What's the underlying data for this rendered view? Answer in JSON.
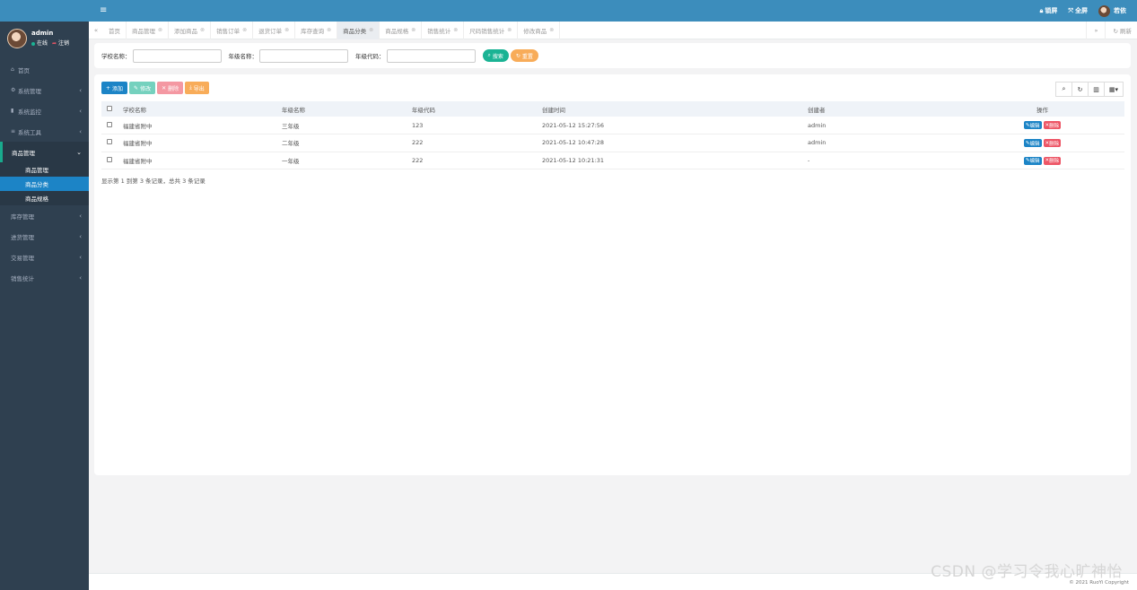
{
  "sidebar": {
    "user": {
      "name": "admin",
      "status": "在线",
      "logout": "注销"
    },
    "menu": [
      {
        "label": "首页",
        "icon": "home-icon"
      },
      {
        "label": "系统管理",
        "icon": "gear-icon"
      },
      {
        "label": "系统监控",
        "icon": "video-icon"
      },
      {
        "label": "系统工具",
        "icon": "bars-icon"
      },
      {
        "label": "商品管理",
        "open": true
      },
      {
        "label": "库存管理"
      },
      {
        "label": "进货管理"
      },
      {
        "label": "交易管理"
      },
      {
        "label": "销售统计"
      }
    ],
    "submenu": [
      {
        "label": "商品管理"
      },
      {
        "label": "商品分类",
        "active": true
      },
      {
        "label": "商品规格"
      }
    ]
  },
  "topbar": {
    "lock": "锁屏",
    "fullscreen": "全屏",
    "user": "若依"
  },
  "tabs": [
    {
      "label": "首页"
    },
    {
      "label": "商品管理"
    },
    {
      "label": "添加商品"
    },
    {
      "label": "销售订单"
    },
    {
      "label": "退货订单"
    },
    {
      "label": "库存查询"
    },
    {
      "label": "商品分类",
      "active": true
    },
    {
      "label": "商品规格"
    },
    {
      "label": "销售统计"
    },
    {
      "label": "尺码销售统计"
    },
    {
      "label": "修改商品"
    }
  ],
  "tabs_refresh": "刷新",
  "search": {
    "school_label": "学校名称：",
    "grade_label": "年级名称：",
    "code_label": "年级代码：",
    "search_btn": "搜索",
    "reset_btn": "重置"
  },
  "toolbar": {
    "add": "添加",
    "edit": "修改",
    "delete": "删除",
    "export": "导出"
  },
  "table": {
    "headers": [
      "学校名称",
      "年级名称",
      "年级代码",
      "创建时间",
      "创建者",
      "操作"
    ],
    "rows": [
      [
        "福建省附中",
        "三年级",
        "123",
        "2021-05-12 15:27:56",
        "admin"
      ],
      [
        "福建省附中",
        "二年级",
        "222",
        "2021-05-12 10:47:28",
        "admin"
      ],
      [
        "福建省附中",
        "一年级",
        "222",
        "2021-05-12 10:21:31",
        "-"
      ]
    ],
    "op_edit": "编辑",
    "op_delete": "删除"
  },
  "pager": "显示第 1 到第 3 条记录，总共 3 条记录",
  "footer": {
    "copyright": "© 2021 RuoYi Copyright"
  },
  "watermark": "CSDN @学习令我心旷神怡",
  "colors": {
    "sidebar": "#2f4050",
    "topbar": "#3c8dbc",
    "primary": "#1c84c6",
    "success": "#1ab394",
    "danger": "#ed5565",
    "warning": "#f8ac59"
  }
}
